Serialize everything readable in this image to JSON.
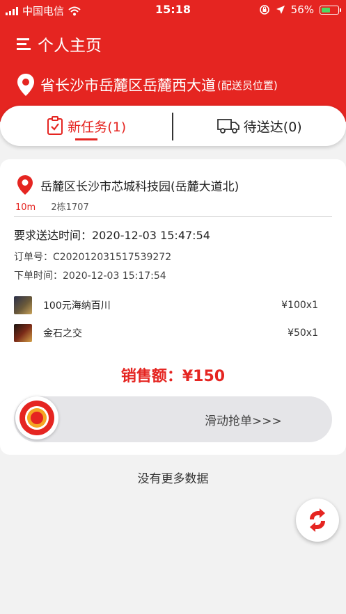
{
  "status_bar": {
    "carrier": "中国电信",
    "time": "15:18",
    "battery": "56%",
    "battery_level": 0.56
  },
  "header": {
    "title": "个人主页",
    "location": "省长沙市岳麓区岳麓西大道",
    "location_note": "(配送员位置)"
  },
  "tabs": [
    {
      "label": "新任务(1)",
      "icon": "clipboard-check-icon",
      "active": true
    },
    {
      "label": "待送达(0)",
      "icon": "truck-icon",
      "active": false
    }
  ],
  "order": {
    "pickup_address": "岳麓区长沙市芯城科技园(岳麓大道北)",
    "distance": "10m",
    "building": "2栋1707",
    "due_time": "要求送达时间：2020-12-03 15:47:54",
    "order_no": "订单号：C202012031517539272",
    "order_time": "下单时间：2020-12-03 15:17:54",
    "items": [
      {
        "name": "100元海纳百川",
        "qty": "¥100x1"
      },
      {
        "name": "金石之交",
        "qty": "¥50x1"
      }
    ],
    "sales": "销售额：¥150",
    "slider_label": "滑动抢单>>>"
  },
  "footer": {
    "no_more": "没有更多数据"
  },
  "colors": {
    "brand_red": "#e52521",
    "knob_orange": "#f5a623"
  }
}
